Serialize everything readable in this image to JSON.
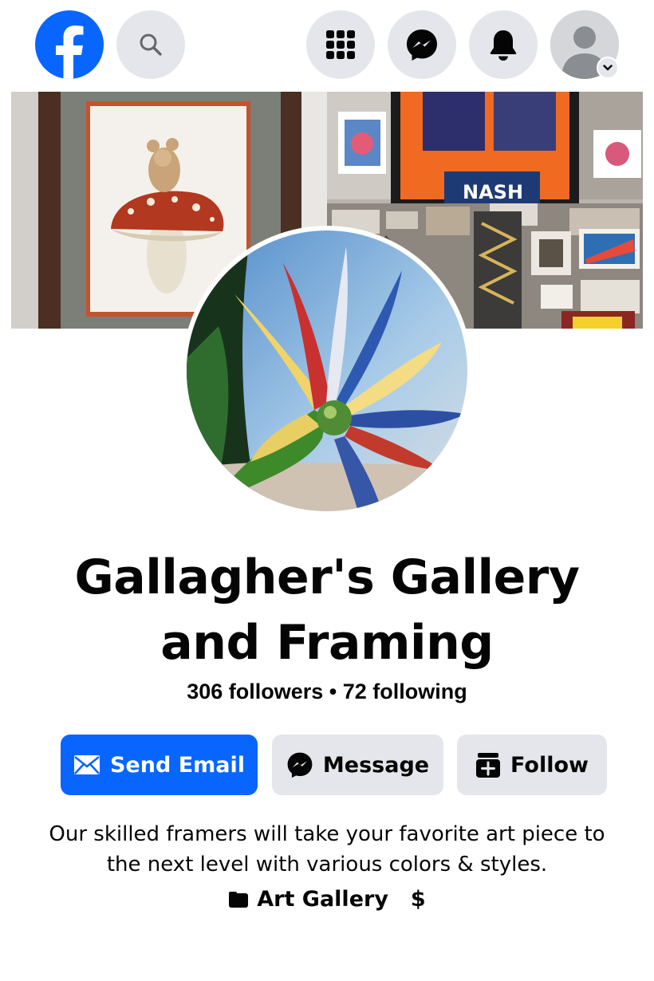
{
  "nav": {
    "logo_icon": "facebook-logo",
    "search_icon": "search-icon",
    "menu_icon": "grid-menu-icon",
    "messenger_icon": "messenger-icon",
    "notifications_icon": "bell-icon",
    "profile_icon": "avatar-icon",
    "accent": "#0866ff"
  },
  "page": {
    "name": "Gallagher's Gallery and Framing",
    "stats": "306 followers • 72 following"
  },
  "actions": {
    "send_email": "Send Email",
    "message": "Message",
    "follow": "Follow"
  },
  "bio": {
    "text": "Our skilled framers will take your favorite art piece to the next level with various colors & styles.",
    "category": "Art Gallery",
    "price": "$"
  }
}
